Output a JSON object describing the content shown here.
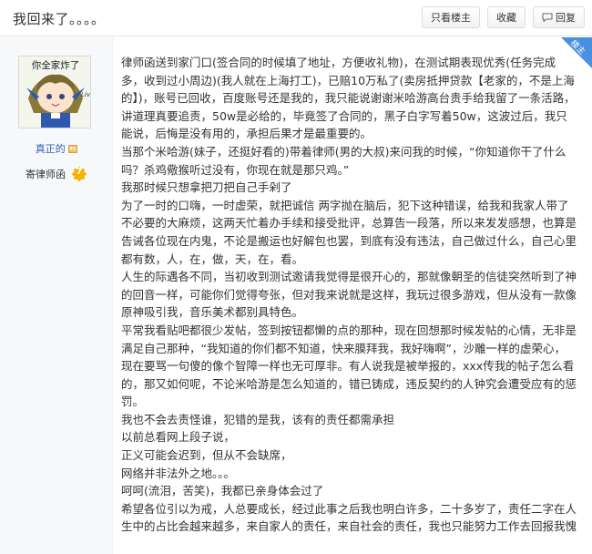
{
  "header": {
    "title": "我回来了。。。。",
    "only_author_label": "只看楼主",
    "collect_label": "收藏",
    "reply_label": "回复"
  },
  "author": {
    "name": "真正的",
    "tag": "寄律师函",
    "level": "7",
    "louzhu_label": "楼主",
    "avatar_text": "你全家炸了"
  },
  "post": {
    "paragraphs": [
      "律师函送到家门口(签合同的时候填了地址，方便收礼物)，在测试期表现优秀(任务完成多，收到过小周边)(我人就在上海打工)，已赔10万私了(卖房抵押贷款【老家的，不是上海的】)，账号已回收，百度账号还是我的，我只能说谢谢米哈游高台贵手给我留了一条活路，讲道理真要追责，50w是必给的，毕竟签了合同的，黑子白字写着50w，这波过后，我只能说，后悔是没有用的，承担后果才是最重要的。",
      "当那个米哈游(妹子，还挺好看的)带着律师(男的大叔)来问我的时候，“你知道你干了什么吗？杀鸡儆猴听过没有，你现在就是那只鸡。”",
      "我那时候只想拿把刀把自己手剁了",
      "为了一时的口嗨，一时虚荣，就把诚信 两字抛在脑后，犯下这种错误，给我和我家人带了不必要的大麻烦，这两天忙着办手续和接受批评，总算告一段落，所以来发发感想，也算是告诫各位现在内鬼，不论是搬运也好解包也罢，到底有没有违法，自己做过什么，自己心里都有数，人，在，做，天，在，看。",
      "人生的际遇各不同，当初收到测试邀请我觉得是很开心的，那就像朝圣的信徒突然听到了神的回音一样，可能你们觉得夸张，但对我来说就是这样，我玩过很多游戏，但从没有一款像原神吸引我，音乐美术都别具特色。",
      "平常我看贴吧都很少发帖，签到按钮都懒的点的那种，现在回想那时候发帖的心情，无非是满足自己那种，“我知道的你们都不知道，快来膜拜我，我好嗨啊”，沙雕一样的虚荣心，现在要骂一句傻的像个智障一样也无可厚非。有人说我是被举报的，xxx传我的帖子怎么看的，那又如何呢，不论米哈游是怎么知道的，错已铸成，违反契约的人钟究会遭受应有的惩罚。",
      "我也不会去责怪谁，犯错的是我，该有的责任都需承担",
      "以前总看网上段子说，",
      "正义可能会迟到，但从不会缺席，",
      "网络并非法外之地。。。",
      "呵呵(流泪，苦笑)，我都已亲身体会过了",
      "希望各位引以为戒，人总要成长，经过此事之后我也明白许多，二十多岁了，责任二字在人生中的占比会越来越多，来自家人的责任，来自社会的责任，我也只能努力工作去回报我愧"
    ]
  },
  "colors": {
    "link_blue": "#2d64b3",
    "louzhu_blue": "#4a90e2",
    "level_badge": "#f5b300"
  }
}
